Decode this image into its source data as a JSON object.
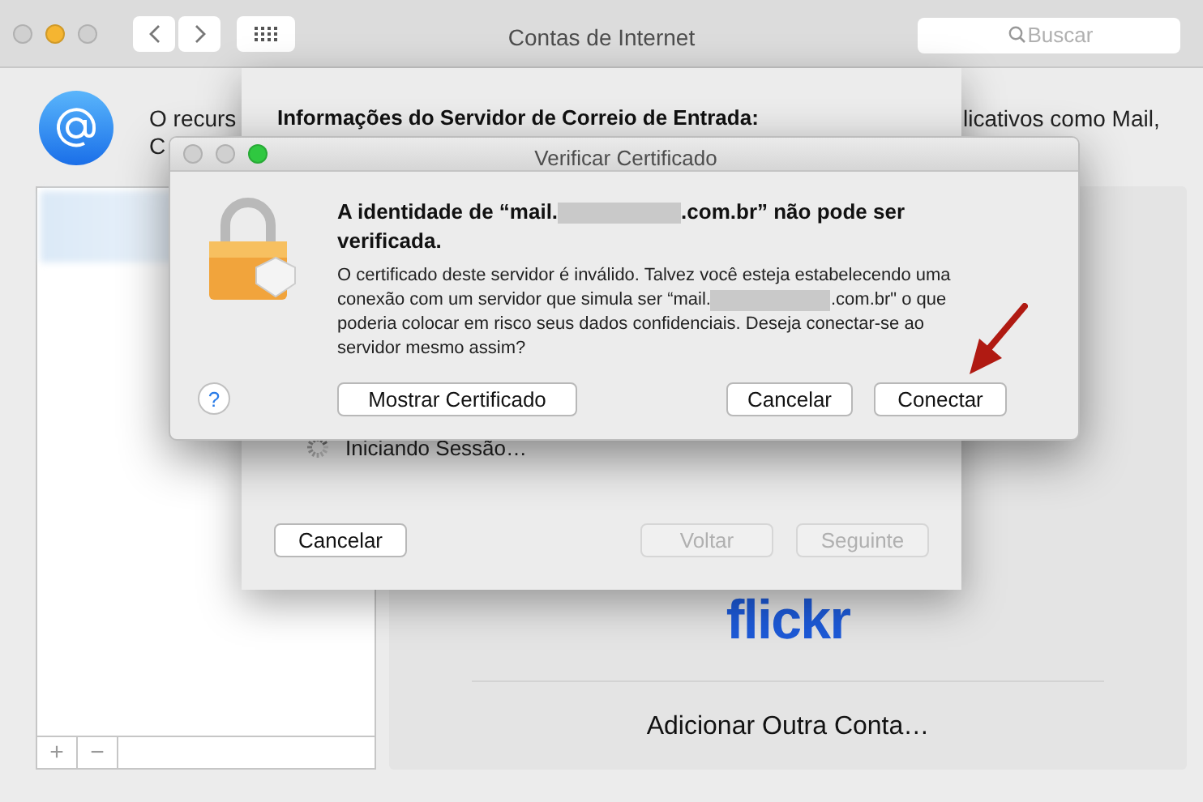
{
  "window": {
    "title": "Contas de Internet",
    "search": {
      "placeholder": "Buscar"
    }
  },
  "intro": {
    "left": "O recurs",
    "right": "licativos como Mail,",
    "second_line": "C"
  },
  "account_list": {
    "buttons": [
      "+",
      "−"
    ]
  },
  "providers": [
    {
      "kind": "logo",
      "label": "flickr"
    },
    {
      "kind": "text",
      "label": "Adicionar Outra Conta…"
    }
  ],
  "setup_sheet": {
    "title": "Informações do Servidor de Correio de Entrada:",
    "status": "Iniciando Sessão…",
    "buttons": [
      {
        "label": "Cancelar",
        "disabled": false
      },
      {
        "label": "Voltar",
        "disabled": true
      },
      {
        "label": "Seguinte",
        "disabled": true
      }
    ]
  },
  "dialog": {
    "title": "Verificar Certificado",
    "heading": {
      "before": "A identidade de “mail.",
      "after": ".com.br” não pode ser verificada."
    },
    "message": {
      "before": "O certificado deste servidor é inválido. Talvez você esteja estabelecendo uma conexão com um servidor que simula ser “mail.",
      "after": ".com.br\" o que poderia colocar em risco seus dados confidenciais. Deseja conectar-se ao servidor mesmo assim?"
    },
    "help": "?",
    "buttons": [
      "Mostrar Certificado",
      "Cancelar",
      "Conectar"
    ]
  }
}
